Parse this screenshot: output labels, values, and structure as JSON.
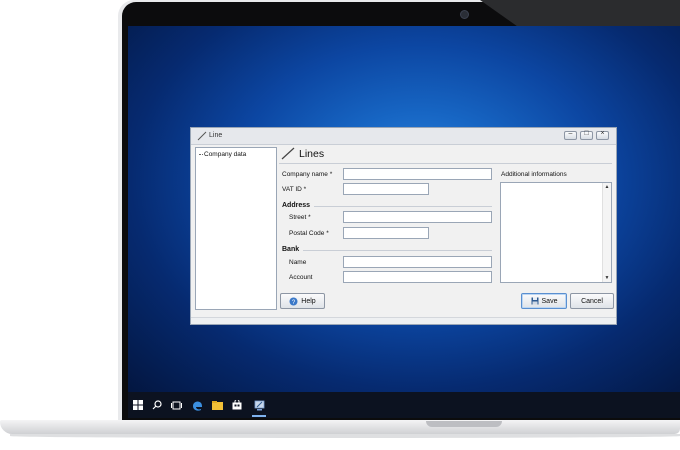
{
  "window": {
    "title": "Line",
    "controls": [
      "minimize",
      "maximize",
      "close"
    ]
  },
  "tree": {
    "items": [
      "Company data"
    ]
  },
  "form": {
    "header_title": "Lines",
    "company_name_label": "Company name *",
    "company_name_value": "",
    "vat_id_label": "VAT ID *",
    "vat_id_value": "",
    "address_section": "Address",
    "street_label": "Street *",
    "street_value": "",
    "postal_code_label": "Postal Code *",
    "postal_code_value": "",
    "bank_section": "Bank",
    "bank_name_label": "Name",
    "bank_name_value": "",
    "account_label": "Account",
    "account_value": "",
    "additional_info_label": "Additional informations",
    "additional_info_value": ""
  },
  "buttons": {
    "help": "Help",
    "save": "Save",
    "cancel": "Cancel"
  },
  "taskbar": {
    "icons": [
      "windows-start-icon",
      "search-icon",
      "task-view-icon",
      "edge-browser-icon",
      "file-explorer-icon",
      "store-icon",
      "app-icon"
    ]
  },
  "colors": {
    "desktop_center": "#2f86df",
    "desktop_edge": "#031640",
    "accent": "#5a8fd0"
  }
}
